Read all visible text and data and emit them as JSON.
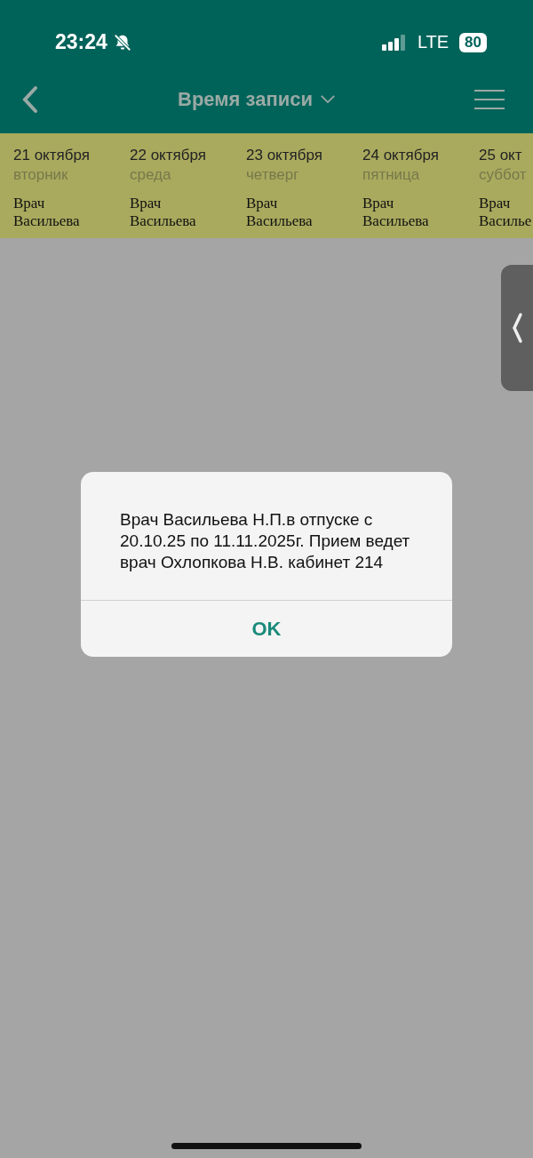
{
  "status_bar": {
    "time": "23:24",
    "network": "LTE",
    "battery": "80"
  },
  "header": {
    "title": "Время записи"
  },
  "days": [
    {
      "date": "21 октября",
      "weekday": "вторник",
      "doctor": [
        "Врач",
        "Васильева"
      ]
    },
    {
      "date": "22 октября",
      "weekday": "среда",
      "doctor": [
        "Врач",
        "Васильева"
      ]
    },
    {
      "date": "23 октября",
      "weekday": "четверг",
      "doctor": [
        "Врач",
        "Васильева"
      ]
    },
    {
      "date": "24 октября",
      "weekday": "пятница",
      "doctor": [
        "Врач",
        "Васильева"
      ]
    },
    {
      "date": "25 окт",
      "weekday": "суббот",
      "doctor": [
        "Врач",
        "Василье"
      ]
    }
  ],
  "dialog": {
    "message": "Врач Васильева Н.П.в отпуске с 20.10.25 по 11.11.2025г. Прием ведет врач Охлопкова Н.В. кабинет 214",
    "button": "OK"
  }
}
